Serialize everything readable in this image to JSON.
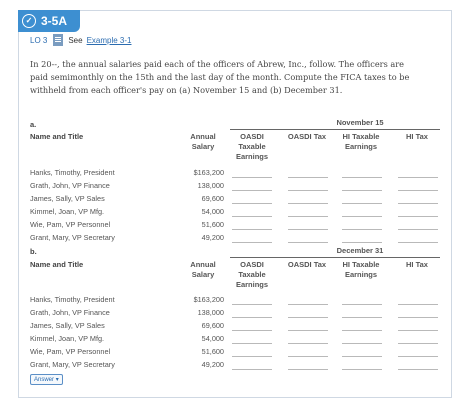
{
  "problem": {
    "id": "3-5A",
    "lo": "LO 3",
    "see_text": "See",
    "see_link": "Example 3-1",
    "intro": "In 20--, the annual salaries paid each of the officers of Abrew, Inc., follow. The officers are paid semimonthly on the 15th and the last day of the month. Compute the FICA taxes to be withheld from each officer's pay on (a) November 15 and (b) December 31."
  },
  "part_a": {
    "label": "a.",
    "date": "November 15",
    "name_header": "Name and Title",
    "annual_header": "Annual Salary",
    "cols": [
      "OASDI Taxable Earnings",
      "OASDI Tax",
      "HI Taxable Earnings",
      "HI Tax"
    ]
  },
  "part_b": {
    "label": "b.",
    "date": "December 31",
    "name_header": "Name and Title",
    "annual_header": "Annual Salary",
    "cols": [
      "OASDI Taxable Earnings",
      "OASDI Tax",
      "HI Taxable Earnings",
      "HI Tax"
    ]
  },
  "officers": [
    {
      "name": "Hanks, Timothy, President",
      "salary": "$163,200"
    },
    {
      "name": "Grath, John, VP Finance",
      "salary": "138,000"
    },
    {
      "name": "James, Sally, VP Sales",
      "salary": "69,600"
    },
    {
      "name": "Kimmel, Joan, VP Mfg.",
      "salary": "54,000"
    },
    {
      "name": "Wie, Pam, VP Personnel",
      "salary": "51,600"
    },
    {
      "name": "Grant, Mary, VP Secretary",
      "salary": "49,200"
    }
  ],
  "answer_button": "Answer"
}
